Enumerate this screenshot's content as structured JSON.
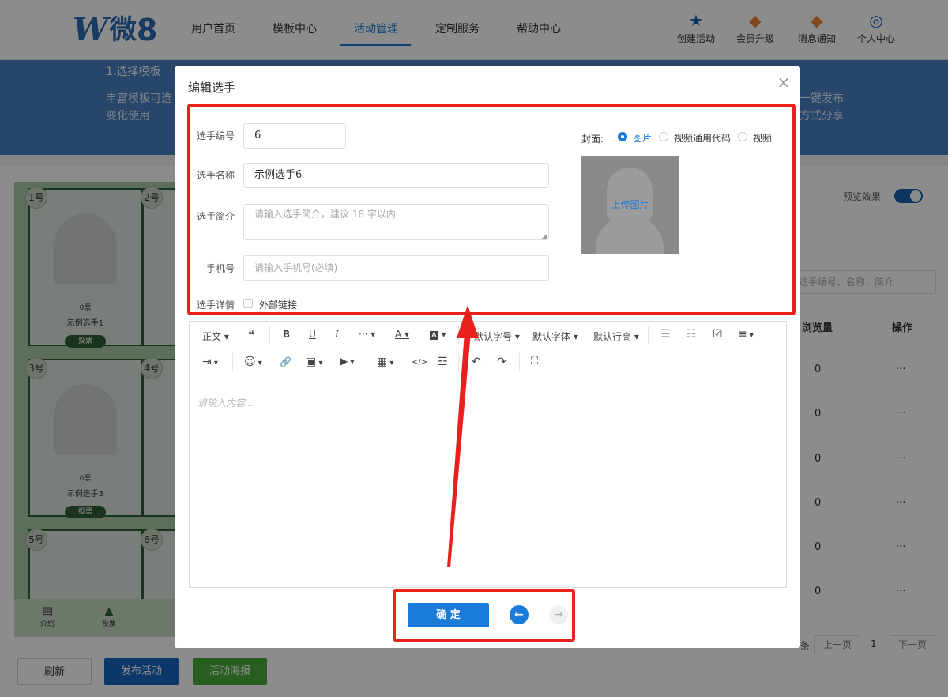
{
  "header": {
    "logo_w": "W",
    "logo_cn": "微",
    "logo_num": "8",
    "nav": [
      "用户首页",
      "模板中心",
      "活动管理",
      "定制服务",
      "帮助中心"
    ],
    "actions": [
      {
        "label": "创建活动",
        "icon": "star-icon"
      },
      {
        "label": "会员升级",
        "icon": "gem-icon"
      },
      {
        "label": "消息通知",
        "icon": "gem-bell-icon"
      },
      {
        "label": "个人中心",
        "icon": "user-icon"
      }
    ]
  },
  "banner": {
    "step1": "1.选择模板",
    "desc1a": "丰富模板可选",
    "desc1b": "变化使用",
    "right1": "一键发布",
    "right2": "方式分享"
  },
  "background": {
    "cards": [
      {
        "num": "1号",
        "votes": "0票",
        "name": "示例选手1",
        "vote_btn": "投票"
      },
      {
        "num": "2号"
      },
      {
        "num": "3号",
        "votes": "0票",
        "name": "示例选手3",
        "vote_btn": "投票"
      },
      {
        "num": "4号"
      },
      {
        "num": "5号"
      },
      {
        "num": "6号"
      }
    ],
    "bottom_tabs": [
      "介绍",
      "投票"
    ],
    "preview_label": "预览效果",
    "search_placeholder": "选手编号、名称、简介",
    "table_headers": [
      "浏览量",
      "操作"
    ],
    "table_rows": [
      {
        "views": "0",
        "ops": "···"
      },
      {
        "views": "0",
        "ops": "···"
      },
      {
        "views": "0",
        "ops": "···"
      },
      {
        "views": "0",
        "ops": "···"
      },
      {
        "views": "0",
        "ops": "···"
      },
      {
        "views": "0",
        "ops": "···"
      }
    ],
    "pager": {
      "suffix": "条",
      "prev": "上一页",
      "page": "1",
      "next": "下一页"
    },
    "buttons": {
      "refresh": "刷新",
      "publish": "发布活动",
      "poster": "活动海报"
    }
  },
  "modal": {
    "title": "编辑选手",
    "close": "×",
    "fields": {
      "number": {
        "label": "选手编号",
        "value": "6"
      },
      "name": {
        "label": "选手名称",
        "value": "示例选手6"
      },
      "intro": {
        "label": "选手简介",
        "placeholder": "请输入选手简介，建议 18 字以内"
      },
      "phone": {
        "label": "手机号",
        "placeholder": "请输入手机号(必填)"
      },
      "detail": {
        "label": "选手详情",
        "checkbox": "外部链接"
      }
    },
    "cover": {
      "label": "封面:",
      "options": [
        "图片",
        "视频通用代码",
        "视频"
      ],
      "selected": "图片",
      "upload": "上传图片"
    },
    "toolbar_row1": [
      "正文",
      "❝",
      "B",
      "U",
      "I",
      "···",
      "A",
      "A",
      "默认字号",
      "默认字体",
      "默认行高",
      "☰",
      "☷",
      "☑",
      "≡"
    ],
    "toolbar_row2": [
      "⇥",
      "☺",
      "🔗",
      "▣",
      "▶",
      "▦",
      "</>",
      "☲",
      "↶",
      "↷",
      "⛶"
    ],
    "editor_placeholder": "请输入内容...",
    "confirm": "确 定",
    "prev_arrow": "←",
    "next_arrow": "→"
  },
  "colors": {
    "primary": "#1b7bd8",
    "annotation_red": "#e8211e",
    "publish_blue": "#1565c0",
    "poster_green": "#4aab3a"
  }
}
